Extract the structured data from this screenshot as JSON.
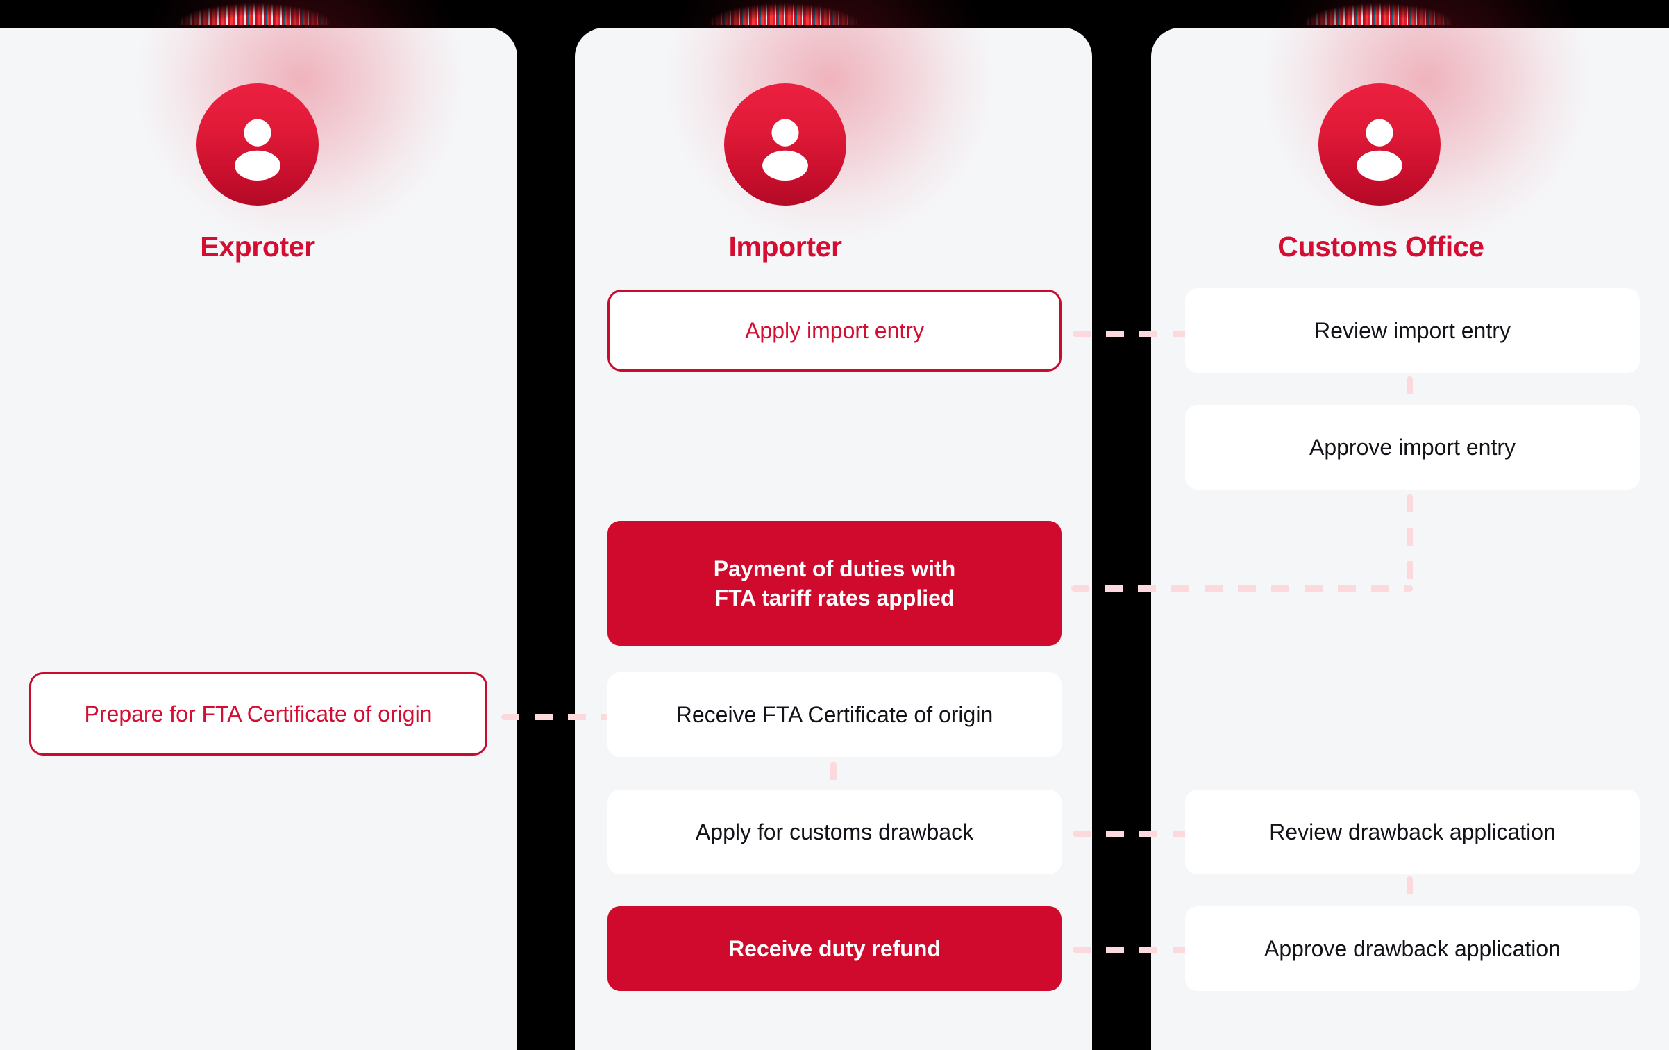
{
  "theme": {
    "accent_red": "#d30e32",
    "filled_red": "#cf0a2c",
    "outline_red": "#c80c2e",
    "card_bg": "#f5f6f8",
    "box_bg": "#ffffff",
    "text_dark": "#111318",
    "connector_pink": "#fcd9dc",
    "page_bg": "#000000"
  },
  "columns": [
    {
      "id": "exporter",
      "title": "Exproter",
      "avatar_icon": "person-avatar-icon",
      "steps": [
        {
          "id": "prepare-fta-certificate",
          "label": "Prepare for FTA Certificate of origin",
          "style": "outline"
        }
      ]
    },
    {
      "id": "importer",
      "title": "Importer",
      "avatar_icon": "person-avatar-icon",
      "steps": [
        {
          "id": "apply-import-entry",
          "label": "Apply import entry",
          "style": "outline"
        },
        {
          "id": "payment-of-duties",
          "label_line1": "Payment of duties with",
          "label_line2": "FTA tariff rates applied",
          "style": "filled"
        },
        {
          "id": "receive-fta-certificate",
          "label": "Receive FTA Certificate of origin",
          "style": "plain"
        },
        {
          "id": "apply-customs-drawback",
          "label": "Apply for customs drawback",
          "style": "plain"
        },
        {
          "id": "receive-duty-refund",
          "label": "Receive duty refund",
          "style": "filled"
        }
      ]
    },
    {
      "id": "customs-office",
      "title": "Customs Office",
      "avatar_icon": "person-avatar-icon",
      "steps": [
        {
          "id": "review-import-entry",
          "label": "Review import entry",
          "style": "plain"
        },
        {
          "id": "approve-import-entry",
          "label": "Approve import entry",
          "style": "plain"
        },
        {
          "id": "review-drawback-application",
          "label": "Review drawback application",
          "style": "plain"
        },
        {
          "id": "approve-drawback-application",
          "label": "Approve drawback application",
          "style": "plain"
        }
      ]
    }
  ],
  "connectors": [
    {
      "id": "apply-to-review-import-entry",
      "type": "horizontal"
    },
    {
      "id": "review-to-approve-import-entry",
      "type": "vertical"
    },
    {
      "id": "approve-import-entry-to-payment",
      "type": "elbow"
    },
    {
      "id": "prepare-to-receive-certificate",
      "type": "horizontal"
    },
    {
      "id": "receive-certificate-to-apply-drawback",
      "type": "vertical"
    },
    {
      "id": "apply-drawback-to-review-drawback",
      "type": "horizontal"
    },
    {
      "id": "review-to-approve-drawback",
      "type": "vertical"
    },
    {
      "id": "approve-drawback-to-receive-refund",
      "type": "horizontal"
    }
  ]
}
